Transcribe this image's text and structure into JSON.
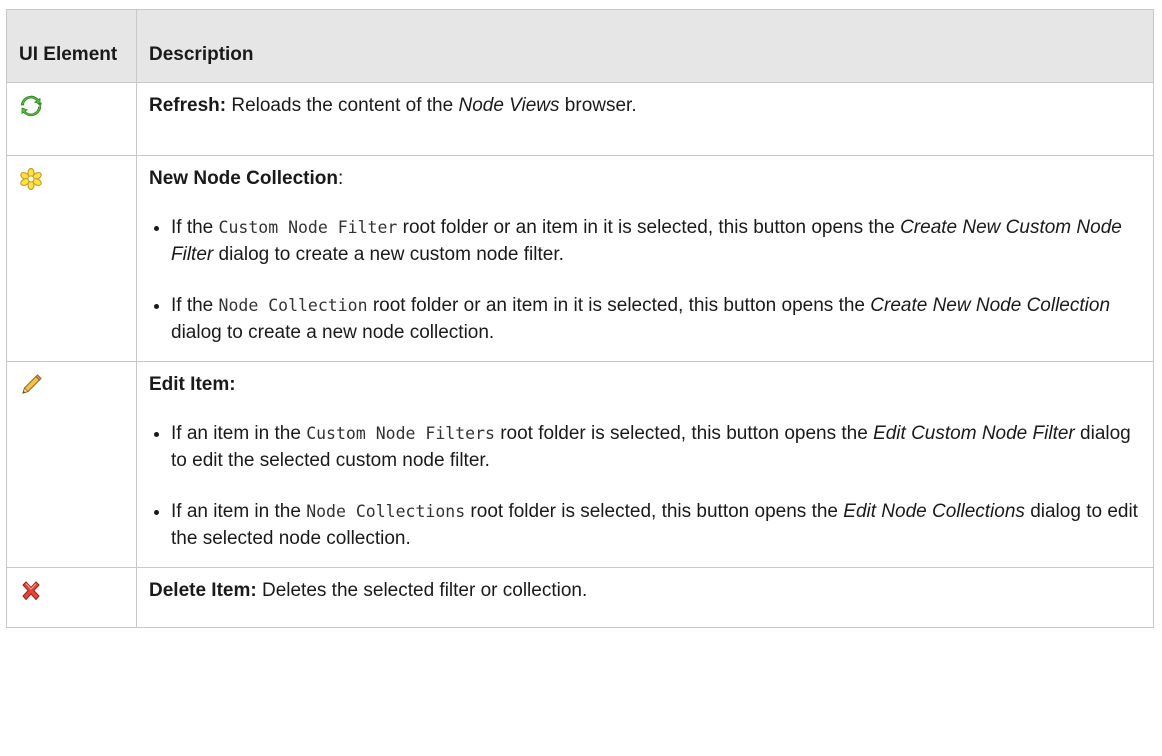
{
  "header": {
    "col1": "UI Element",
    "col2": "Description"
  },
  "rows": [
    {
      "icon": "refresh-icon",
      "title": "Refresh:",
      "text_before": " Reloads the content of the ",
      "italic": "Node Views",
      "text_after": " browser."
    },
    {
      "icon": "new-collection-icon",
      "title": "New Node Collection",
      "title_suffix": ":",
      "bullets": [
        {
          "pre": "If the ",
          "code": "Custom Node Filter",
          "mid": " root folder or an item in it is selected, this button opens the ",
          "italic": "Create New Custom Node Filter",
          "post": " dialog to create a new custom node filter."
        },
        {
          "pre": "If the ",
          "code": "Node Collection",
          "mid": " root folder or an item in it is selected, this button opens the ",
          "italic": "Create New Node Collection",
          "post": " dialog to create a new node collection."
        }
      ]
    },
    {
      "icon": "pencil-icon",
      "title": "Edit Item:",
      "bullets": [
        {
          "pre": "If an item in the ",
          "code": "Custom Node Filters",
          "mid": " root folder is selected, this button opens the ",
          "italic": "Edit Custom Node Filter",
          "post": " dialog to edit the selected custom node filter."
        },
        {
          "pre": "If an item in the ",
          "code": "Node Collections",
          "mid": " root folder is selected, this button opens the ",
          "italic": "Edit Node Collections",
          "post": " dialog to edit the selected node collection."
        }
      ]
    },
    {
      "icon": "delete-icon",
      "title": "Delete Item:",
      "text_before": " Deletes the selected filter or collection."
    }
  ]
}
